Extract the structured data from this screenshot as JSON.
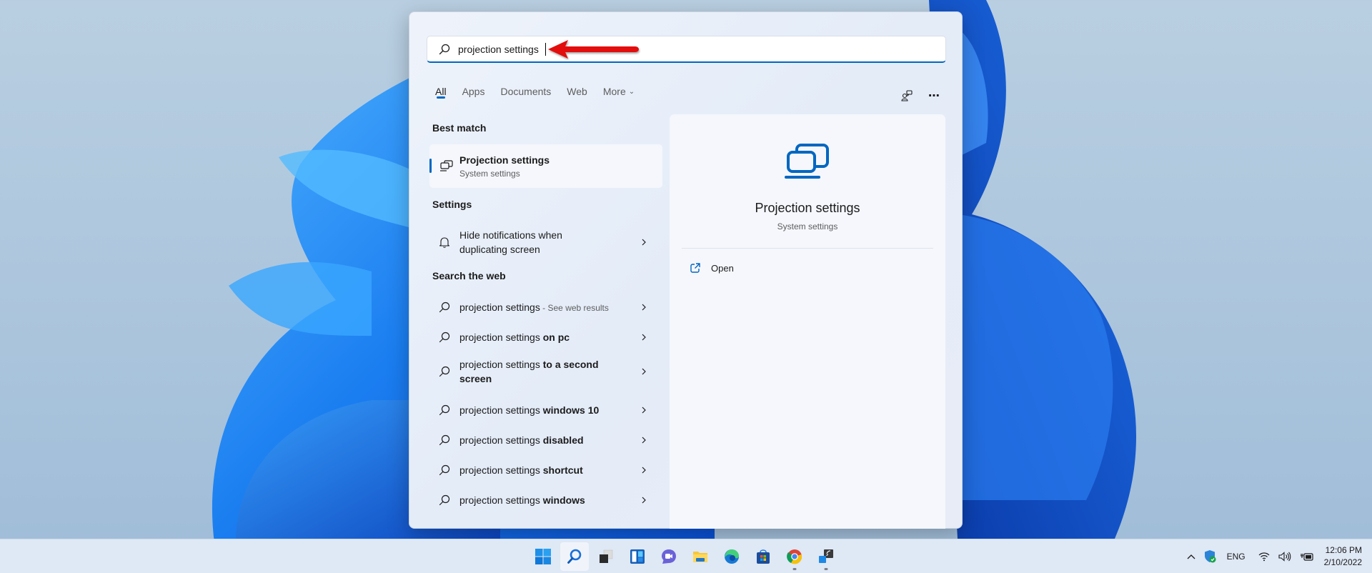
{
  "search": {
    "query": "projection settings",
    "tabs": [
      {
        "label": "All",
        "active": true
      },
      {
        "label": "Apps",
        "active": false
      },
      {
        "label": "Documents",
        "active": false
      },
      {
        "label": "Web",
        "active": false
      },
      {
        "label": "More",
        "active": false
      }
    ],
    "top_icons": [
      "share-feedback-icon",
      "more-options-icon"
    ]
  },
  "results": {
    "best_match_heading": "Best match",
    "best_match": {
      "title": "Projection settings",
      "subtitle": "System settings",
      "icon": "projection-icon"
    },
    "settings_heading": "Settings",
    "settings_items": [
      {
        "line1": "Hide notifications when",
        "line2": "duplicating screen",
        "icon": "bell-icon"
      }
    ],
    "web_heading": "Search the web",
    "web_items": [
      {
        "prefix": "projection settings",
        "suffix": "",
        "note": " - See web results"
      },
      {
        "prefix": "projection settings ",
        "suffix": "on pc",
        "note": ""
      },
      {
        "prefix": "projection settings ",
        "suffix": "to a second screen",
        "note": ""
      },
      {
        "prefix": "projection settings ",
        "suffix": "windows 10",
        "note": ""
      },
      {
        "prefix": "projection settings ",
        "suffix": "disabled",
        "note": ""
      },
      {
        "prefix": "projection settings ",
        "suffix": "shortcut",
        "note": ""
      },
      {
        "prefix": "projection settings ",
        "suffix": "windows",
        "note": ""
      }
    ]
  },
  "preview": {
    "title": "Projection settings",
    "subtitle": "System settings",
    "actions": [
      {
        "label": "Open",
        "icon": "open-external-icon"
      }
    ]
  },
  "taskbar": {
    "apps": [
      {
        "name": "start",
        "icon": "windows-start-icon"
      },
      {
        "name": "search",
        "icon": "search-icon",
        "active": true
      },
      {
        "name": "task-view",
        "icon": "task-view-icon"
      },
      {
        "name": "widgets",
        "icon": "widgets-icon"
      },
      {
        "name": "teams-chat",
        "icon": "chat-icon"
      },
      {
        "name": "file-explorer",
        "icon": "folder-icon"
      },
      {
        "name": "edge",
        "icon": "edge-icon"
      },
      {
        "name": "store",
        "icon": "store-icon"
      },
      {
        "name": "chrome",
        "icon": "chrome-icon",
        "running": true
      },
      {
        "name": "project",
        "icon": "cast-display-icon",
        "running": true
      }
    ],
    "tray": {
      "language": "ENG",
      "time": "12:06 PM",
      "date": "2/10/2022"
    }
  },
  "colors": {
    "accent": "#0067c0",
    "annotation_arrow": "#e00000"
  }
}
